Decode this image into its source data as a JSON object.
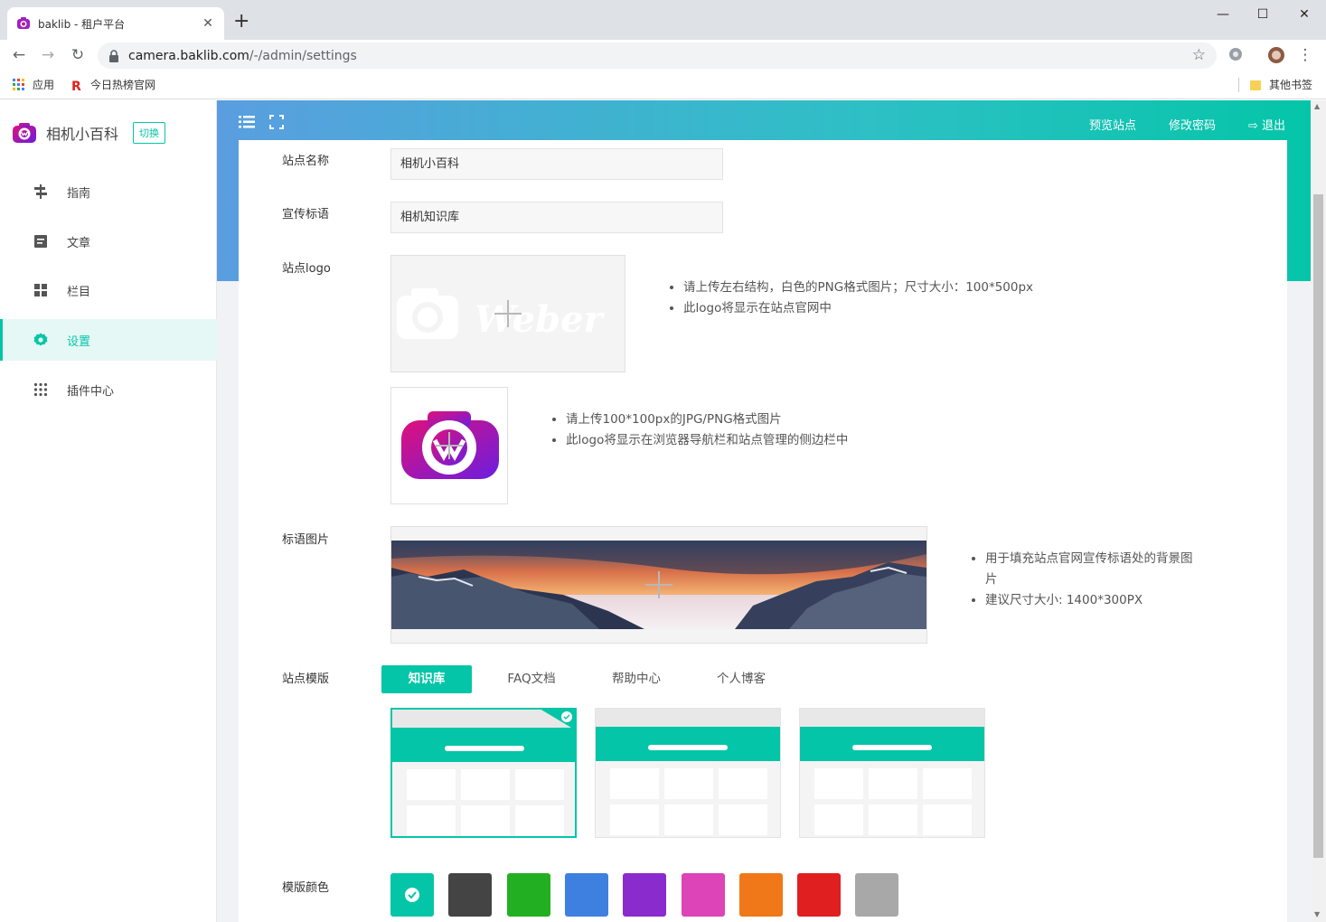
{
  "browser": {
    "tab_title": "baklib - 租户平台",
    "tab_close": "✕",
    "new_tab": "+",
    "url_host": "camera.baklib.com",
    "url_path": "/-/admin/settings",
    "bookmarks": [
      {
        "label": "应用",
        "icon": "apps-grid-icon"
      },
      {
        "label": "今日热榜官网",
        "icon": "r-logo-icon"
      }
    ],
    "other_bookmarks": "其他书签",
    "window_controls": [
      "—",
      "☐",
      "✕"
    ]
  },
  "sidebar": {
    "site_name": "相机小百科",
    "switch_label": "切换",
    "items": [
      {
        "label": "指南",
        "icon": "signpost-icon"
      },
      {
        "label": "文章",
        "icon": "document-icon"
      },
      {
        "label": "栏目",
        "icon": "grid-icon"
      },
      {
        "label": "设置",
        "icon": "gear-icon",
        "active": true
      },
      {
        "label": "插件中心",
        "icon": "dots-grid-icon"
      }
    ]
  },
  "header": {
    "preview_label": "预览站点",
    "password_label": "修改密码",
    "logout_label": "退出"
  },
  "form": {
    "site_name_label": "站点名称",
    "site_name_value": "相机小百科",
    "slogan_label": "宣传标语",
    "slogan_value": "相机知识库",
    "logo_label": "站点logo",
    "logo_hint_1": "请上传左右结构，白色的PNG格式图片；尺寸大小：100*500px",
    "logo_hint_2": "此logo将显示在站点官网中",
    "favicon_hint_1": "请上传100*100px的JPG/PNG格式图片",
    "favicon_hint_2": "此logo将显示在浏览器导航栏和站点管理的侧边栏中",
    "banner_label": "标语图片",
    "banner_hint_1": "用于填充站点官网宣传标语处的背景图片",
    "banner_hint_2": "建议尺寸大小: 1400*300PX",
    "template_label": "站点模版",
    "template_tabs": [
      "知识库",
      "FAQ文档",
      "帮助中心",
      "个人博客"
    ],
    "color_label": "模版颜色"
  },
  "colors": {
    "accent": "#05c5a8",
    "swatches": [
      "#05c5a8",
      "#444444",
      "#22b022",
      "#3d80e0",
      "#8a2bcd",
      "#dc44b8",
      "#f07818",
      "#e02020",
      "#a8a8a8"
    ],
    "selected_swatch": 0
  }
}
